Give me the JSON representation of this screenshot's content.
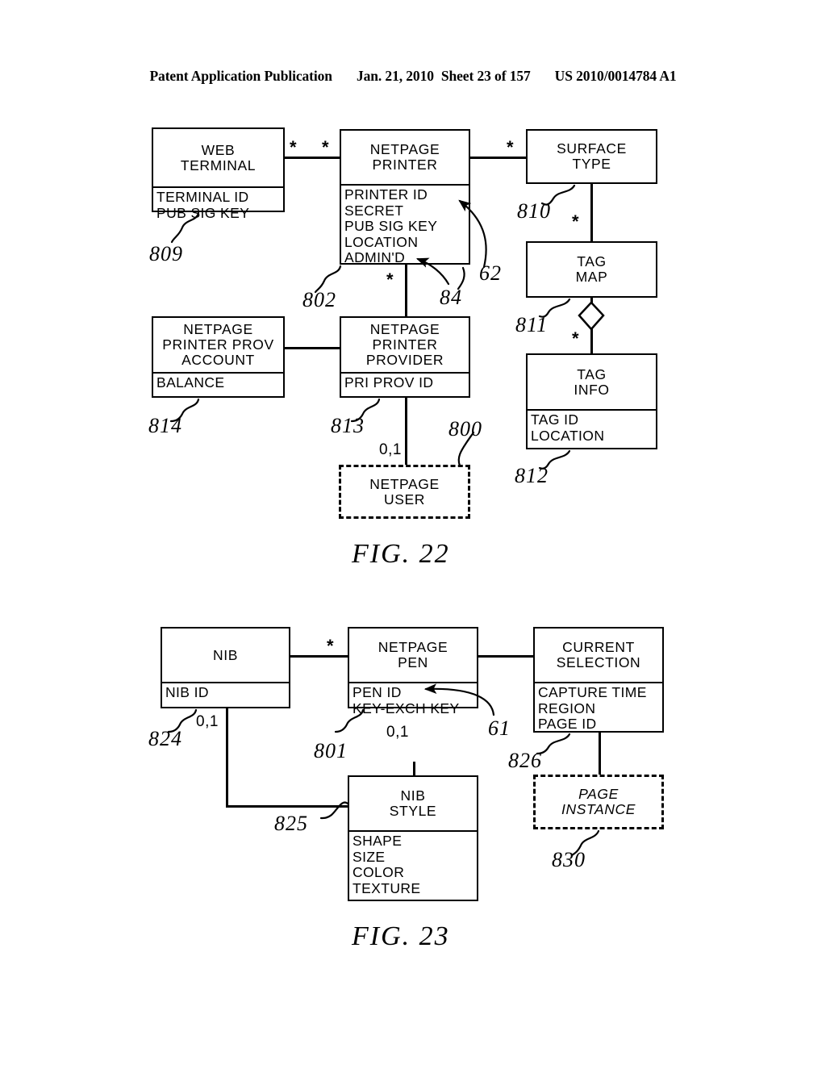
{
  "header": {
    "publication": "Patent Application Publication",
    "date": "Jan. 21, 2010",
    "sheet": "Sheet 23 of 157",
    "docnumber": "US 2010/0014784 A1"
  },
  "figures": [
    {
      "caption": "FIG. 22",
      "entities": [
        {
          "id": "web-terminal",
          "title": [
            "WEB",
            "TERMINAL"
          ],
          "attributes": [
            "TERMINAL ID",
            "PUB SIG KEY"
          ],
          "ref": "809",
          "dashed": false
        },
        {
          "id": "netpage-printer",
          "title": [
            "NETPAGE",
            "PRINTER"
          ],
          "attributes": [
            "PRINTER ID",
            "SECRET",
            "PUB SIG KEY",
            "LOCATION",
            "ADMIN'D"
          ],
          "ref": "802",
          "dashed": false
        },
        {
          "id": "surface-type",
          "title": [
            "SURFACE",
            "TYPE"
          ],
          "attributes": [],
          "ref": "810",
          "dashed": false
        },
        {
          "id": "tag-map",
          "title": [
            "TAG",
            "MAP"
          ],
          "attributes": [],
          "ref": "811",
          "dashed": false
        },
        {
          "id": "tag-info",
          "title": [
            "TAG",
            "INFO"
          ],
          "attributes": [
            "TAG ID",
            "LOCATION"
          ],
          "ref": "812",
          "dashed": false
        },
        {
          "id": "netpage-printer-prov-account",
          "title": [
            "NETPAGE",
            "PRINTER PROV",
            "ACCOUNT"
          ],
          "attributes": [
            "BALANCE"
          ],
          "ref": "814",
          "dashed": false
        },
        {
          "id": "netpage-printer-provider",
          "title": [
            "NETPAGE",
            "PRINTER",
            "PROVIDER"
          ],
          "attributes": [
            "PRI PROV ID"
          ],
          "ref": "813",
          "dashed": false
        },
        {
          "id": "netpage-user",
          "title": [
            "NETPAGE",
            "USER"
          ],
          "attributes": [],
          "ref": "800",
          "dashed": true
        }
      ],
      "extra_refs": [
        "62",
        "84"
      ],
      "multiplicities": [
        "*",
        "*",
        "*",
        "*",
        "*",
        "*",
        "0,1"
      ]
    },
    {
      "caption": "FIG. 23",
      "entities": [
        {
          "id": "nib",
          "title": [
            "NIB"
          ],
          "attributes": [
            "NIB ID"
          ],
          "ref": "824",
          "dashed": false
        },
        {
          "id": "netpage-pen",
          "title": [
            "NETPAGE",
            "PEN"
          ],
          "attributes": [
            "PEN ID",
            "KEY-EXCH KEY"
          ],
          "ref": "801",
          "dashed": false
        },
        {
          "id": "current-selection",
          "title": [
            "CURRENT",
            "SELECTION"
          ],
          "attributes": [
            "CAPTURE TIME",
            "REGION",
            "PAGE ID"
          ],
          "ref": "826",
          "dashed": false
        },
        {
          "id": "nib-style",
          "title": [
            "NIB",
            "STYLE"
          ],
          "attributes": [
            "SHAPE",
            "SIZE",
            "COLOR",
            "TEXTURE"
          ],
          "ref": "825",
          "dashed": false
        },
        {
          "id": "page-instance",
          "title": [
            "PAGE",
            "INSTANCE"
          ],
          "attributes": [],
          "ref": "830",
          "dashed": true
        }
      ],
      "extra_refs": [
        "61"
      ],
      "multiplicities": [
        "*",
        "0,1",
        "0,1"
      ]
    }
  ],
  "labels": {
    "fig22": {
      "caption": "FIG. 22",
      "web_terminal_t1": "WEB",
      "web_terminal_t2": "TERMINAL",
      "web_terminal_a1": "TERMINAL ID",
      "web_terminal_a2": "PUB SIG KEY",
      "web_terminal_ref": "809",
      "netpage_printer_t1": "NETPAGE",
      "netpage_printer_t2": "PRINTER",
      "netpage_printer_a1": "PRINTER ID",
      "netpage_printer_a2": "SECRET",
      "netpage_printer_a3": "PUB SIG KEY",
      "netpage_printer_a4": "LOCATION",
      "netpage_printer_a5": "ADMIN'D",
      "netpage_printer_ref": "802",
      "ref_62": "62",
      "ref_84": "84",
      "surface_type_t1": "SURFACE",
      "surface_type_t2": "TYPE",
      "surface_type_ref": "810",
      "tag_map_t1": "TAG",
      "tag_map_t2": "MAP",
      "tag_map_ref": "811",
      "tag_info_t1": "TAG",
      "tag_info_t2": "INFO",
      "tag_info_a1": "TAG ID",
      "tag_info_a2": "LOCATION",
      "tag_info_ref": "812",
      "nppa_t1": "NETPAGE",
      "nppa_t2": "PRINTER PROV",
      "nppa_t3": "ACCOUNT",
      "nppa_a1": "BALANCE",
      "nppa_ref": "814",
      "npp_t1": "NETPAGE",
      "npp_t2": "PRINTER",
      "npp_t3": "PROVIDER",
      "npp_a1": "PRI PROV ID",
      "npp_ref": "813",
      "netpage_user_t1": "NETPAGE",
      "netpage_user_t2": "USER",
      "netpage_user_ref": "800",
      "m_wt_star": "*",
      "m_np_star": "*",
      "m_st_star": "*",
      "m_tagmap_star": "*",
      "m_taginfo_star": "*",
      "m_provider_star": "*",
      "m_user_zeroone": "0,1"
    },
    "fig23": {
      "caption": "FIG. 23",
      "nib_t1": "NIB",
      "nib_a1": "NIB ID",
      "nib_ref": "824",
      "pen_t1": "NETPAGE",
      "pen_t2": "PEN",
      "pen_a1": "PEN ID",
      "pen_a2": "KEY-EXCH KEY",
      "pen_ref": "801",
      "ref_61": "61",
      "cursel_t1": "CURRENT",
      "cursel_t2": "SELECTION",
      "cursel_a1": "CAPTURE TIME",
      "cursel_a2": "REGION",
      "cursel_a3": "PAGE ID",
      "cursel_ref": "826",
      "nibstyle_t1": "NIB",
      "nibstyle_t2": "STYLE",
      "nibstyle_a1": "SHAPE",
      "nibstyle_a2": "SIZE",
      "nibstyle_a3": "COLOR",
      "nibstyle_a4": "TEXTURE",
      "nibstyle_ref": "825",
      "pageinst_t1": "PAGE",
      "pageinst_t2": "INSTANCE",
      "pageinst_ref": "830",
      "m_nib_star": "*",
      "m_nib_zeroone": "0,1",
      "m_pen_zeroone": "0,1"
    }
  }
}
